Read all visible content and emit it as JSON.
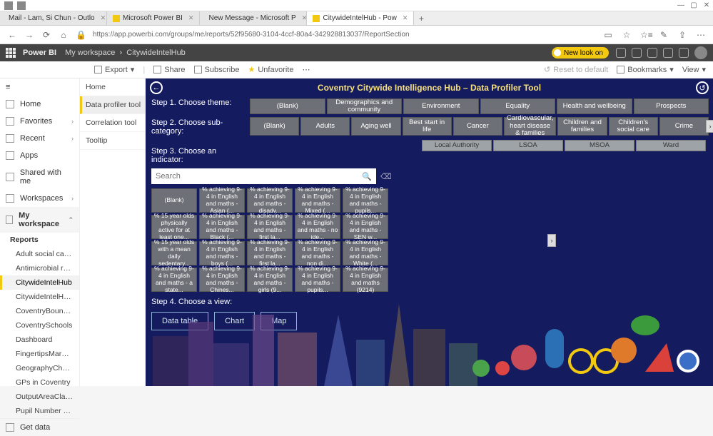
{
  "browser": {
    "tabs": [
      {
        "label": "Mail - Lam, Si Chun - Outlo"
      },
      {
        "label": "Microsoft Power BI"
      },
      {
        "label": "New Message - Microsoft P"
      },
      {
        "label": "CitywideIntelHub - Pow"
      }
    ],
    "url": "https://app.powerbi.com/groups/me/reports/52f95680-3104-4ccf-80a4-342928813037/ReportSection",
    "win": {
      "min": "—",
      "max": "▢",
      "close": "✕"
    }
  },
  "pbi": {
    "brand": "Power BI",
    "crumb1": "My workspace",
    "crumb2": "CitywideIntelHub",
    "newlook": "New look on",
    "toolbar": {
      "export": "Export",
      "share": "Share",
      "subscribe": "Subscribe",
      "unfavorite": "Unfavorite",
      "reset": "Reset to default",
      "bookmarks": "Bookmarks",
      "view": "View"
    }
  },
  "nav": {
    "items": [
      "Home",
      "Favorites",
      "Recent",
      "Apps",
      "Shared with me",
      "Workspaces"
    ],
    "ws": "My workspace",
    "head": "Reports",
    "reports": [
      "Adult social care O...",
      "Antimicrobial resis...",
      "CitywideIntelHub",
      "CitywideIntelHub...",
      "CoventryBoundaries",
      "CoventrySchools",
      "Dashboard",
      "FingertipsMarmot...",
      "GeographyChooser",
      "GPs in Coventry",
      "OutputAreaClassifi...",
      "Pupil Number Gro..."
    ],
    "getdata": "Get data"
  },
  "pages": [
    "Home",
    "Data profiler tool",
    "Correlation tool",
    "Tooltip"
  ],
  "report": {
    "title": "Coventry Citywide Intelligence Hub – Data Profiler Tool",
    "step1": "Step 1. Choose theme:",
    "step2": "Step 2. Choose sub-category:",
    "step3": "Step 3. Choose an indicator:",
    "step4": "Step 4. Choose a view:",
    "themes": [
      "(Blank)",
      "Demographics and community",
      "Environment",
      "Equality",
      "Health and wellbeing",
      "Prospects"
    ],
    "subcats": [
      "(Blank)",
      "Adults",
      "Aging well",
      "Best start in life",
      "Cancer",
      "Cardiovascular, heart disease & families",
      "Children and families",
      "Children's social care",
      "Crime"
    ],
    "geos": [
      "Local Authority",
      "LSOA",
      "MSOA",
      "Ward"
    ],
    "search_ph": "Search",
    "indicators": [
      "(Blank)",
      "% achieving 9-4 in English and maths - Asian (...",
      "% achieving 9-4 in English and maths - disadv...",
      "% achieving 9-4 in English and maths - Mixed (...",
      "% achieving 9-4 in English and maths - pupils...",
      "% 15 year olds physically active for at least one...",
      "% achieving 9-4 in English and maths - Black (...",
      "% achieving 9-4 in English and maths - first la...",
      "% achieving 9-4 in English and maths - no ide...",
      "% achieving 9-4 in English and maths - SEN w...",
      "% 15 year olds with a mean daily sedentary...",
      "% achieving 9-4 in English and maths - boys (...",
      "% achieving 9-4 in English and maths - first la...",
      "% achieving 9-4 in English and maths - non di...",
      "% achieving 9-4 in English and maths - White (...",
      "% achieving 9-4 in English and maths - a state...",
      "% achieving 9-4 in English and maths - Chines...",
      "% achieving 9-4 in English and maths - girls (9...",
      "% achieving 9-4 in English and maths - pupils...",
      "% achieving 9-4 in English and maths (9214)"
    ],
    "views": [
      "Data table",
      "Chart",
      "Map"
    ]
  }
}
